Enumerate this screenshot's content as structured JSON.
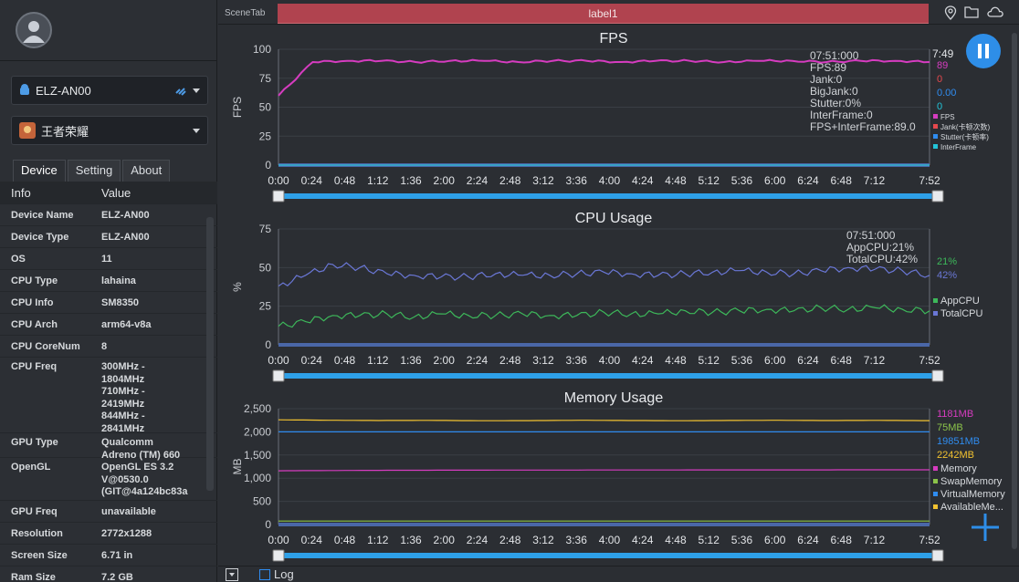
{
  "sidebar": {
    "device_dropdown": "ELZ-AN00",
    "app_dropdown": "王者荣耀",
    "tabs": [
      "Device",
      "Setting",
      "About"
    ],
    "active_tab": "Device",
    "table_headers": [
      "Info",
      "Value"
    ],
    "rows": [
      {
        "k": "Device Name",
        "v": "ELZ-AN00"
      },
      {
        "k": "Device Type",
        "v": "ELZ-AN00"
      },
      {
        "k": "OS",
        "v": "11"
      },
      {
        "k": "CPU Type",
        "v": "lahaina"
      },
      {
        "k": "CPU Info",
        "v": "SM8350"
      },
      {
        "k": "CPU Arch",
        "v": "arm64-v8a"
      },
      {
        "k": "CPU CoreNum",
        "v": "8"
      },
      {
        "k": "CPU Freq",
        "v": "300MHz -\n1804MHz\n710MHz -\n2419MHz\n844MHz -\n2841MHz"
      },
      {
        "k": "GPU Type",
        "v": "Qualcomm\nAdreno (TM) 660"
      },
      {
        "k": "OpenGL",
        "v": "OpenGL ES 3.2\nV@0530.0\n(GIT@4a124bc83a"
      },
      {
        "k": "GPU Freq",
        "v": "unavailable"
      },
      {
        "k": "Resolution",
        "v": "2772x1288"
      },
      {
        "k": "Screen Size",
        "v": "6.71 in"
      },
      {
        "k": "Ram Size",
        "v": "7.2 GB"
      }
    ]
  },
  "topbar": {
    "scene_tab": "SceneTab",
    "label": "label1"
  },
  "bottombar": {
    "log_label": "Log"
  },
  "x_ticks": [
    "0:00",
    "0:24",
    "0:48",
    "1:12",
    "1:36",
    "2:00",
    "2:24",
    "2:48",
    "3:12",
    "3:36",
    "4:00",
    "4:24",
    "4:48",
    "5:12",
    "5:36",
    "6:00",
    "6:24",
    "6:48",
    "7:12",
    "7:52"
  ],
  "colors": {
    "fps": "#d63cc0",
    "jank": "#e5484d",
    "stutter": "#2f8cf0",
    "interframe": "#22c4d8",
    "appcpu": "#3db85a",
    "totalcpu": "#6a77d6",
    "memory": "#d63cc0",
    "swap": "#8bc34a",
    "virtual": "#2f8cf0",
    "available": "#f2c230"
  },
  "chart_data": [
    {
      "type": "line",
      "title": "FPS",
      "ylabel": "FPS",
      "ylim": [
        0,
        100
      ],
      "yticks": [
        "0",
        "25",
        "50",
        "75",
        "100"
      ],
      "tooltip": [
        "07:51:000",
        "FPS:89",
        "Jank:0",
        "BigJank:0",
        "Stutter:0%",
        "InterFrame:0",
        "FPS+InterFrame:89.0"
      ],
      "time_label": "7:49",
      "current_values": [
        "89",
        "0",
        "0.00",
        "0"
      ],
      "series": [
        {
          "name": "FPS",
          "values": [
            60,
            89,
            90,
            90,
            89,
            90,
            90,
            89,
            90,
            90,
            89,
            90,
            90,
            89,
            90,
            90,
            89,
            90,
            90,
            89
          ]
        },
        {
          "name": "Jank(卡顿次数)",
          "values": [
            0,
            0,
            0,
            0,
            0,
            0,
            0,
            0,
            0,
            0,
            0,
            0,
            0,
            0,
            0,
            0,
            0,
            0,
            0,
            0
          ]
        },
        {
          "name": "Stutter(卡顿率)",
          "values": [
            0,
            0,
            0,
            0,
            0,
            0,
            0,
            0,
            0,
            0,
            0,
            0,
            0,
            0,
            0,
            0,
            0,
            0,
            0,
            0
          ]
        },
        {
          "name": "InterFrame",
          "values": [
            0,
            0,
            0,
            0,
            0,
            0,
            0,
            0,
            0,
            0,
            0,
            0,
            0,
            0,
            0,
            0,
            0,
            0,
            0,
            0
          ]
        }
      ]
    },
    {
      "type": "line",
      "title": "CPU Usage",
      "ylabel": "%",
      "ylim": [
        0,
        75
      ],
      "yticks": [
        "0",
        "25",
        "50",
        "75"
      ],
      "tooltip": [
        "07:51:000",
        "AppCPU:21%",
        "TotalCPU:42%"
      ],
      "current_values": [
        "21%",
        "42%"
      ],
      "series": [
        {
          "name": "AppCPU",
          "values": [
            12,
            15,
            19,
            19,
            20,
            18,
            20,
            19,
            19,
            20,
            19,
            19,
            21,
            20,
            20,
            22,
            21,
            22,
            23,
            22,
            24,
            23,
            24,
            23,
            22
          ]
        },
        {
          "name": "TotalCPU",
          "values": [
            38,
            45,
            52,
            50,
            46,
            45,
            44,
            44,
            46,
            45,
            45,
            46,
            47,
            46,
            45,
            46,
            47,
            48,
            47,
            46,
            48,
            50,
            49,
            48,
            45
          ]
        }
      ]
    },
    {
      "type": "line",
      "title": "Memory Usage",
      "ylabel": "MB",
      "ylim": [
        0,
        2500
      ],
      "yticks": [
        "0",
        "500",
        "1,000",
        "1,500",
        "2,000",
        "2,500"
      ],
      "current_values": [
        "1181MB",
        "75MB",
        "19851MB",
        "2242MB"
      ],
      "series": [
        {
          "name": "Memory",
          "values": [
            1160,
            1165,
            1170,
            1172,
            1174,
            1175,
            1176,
            1178,
            1178,
            1179,
            1180,
            1180,
            1181,
            1181
          ]
        },
        {
          "name": "SwapMemory",
          "values": [
            75,
            75,
            75,
            75,
            75,
            75,
            75,
            75,
            75,
            75,
            75,
            75,
            75,
            75
          ]
        },
        {
          "name": "VirtualMemory",
          "values": [
            2000,
            2000,
            2000,
            2000,
            2000,
            2000,
            2000,
            2000,
            2000,
            2000,
            2000,
            2000,
            2000,
            2000
          ]
        },
        {
          "name": "AvailableMe...",
          "values": [
            2260,
            2250,
            2245,
            2248,
            2240,
            2242,
            2250,
            2245,
            2240,
            2246,
            2250,
            2244,
            2248,
            2242
          ]
        }
      ]
    }
  ]
}
